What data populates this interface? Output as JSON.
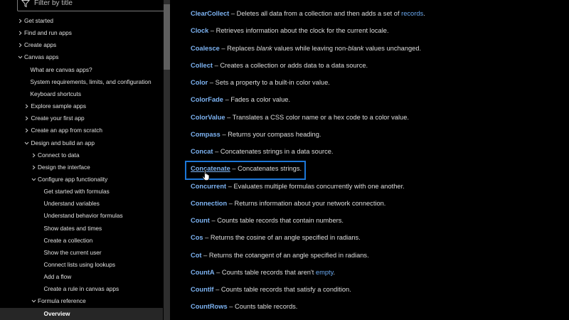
{
  "sidebar": {
    "filter_placeholder": "Filter by title",
    "items": [
      {
        "label": "Get started",
        "chevron": "right"
      },
      {
        "label": "Find and run apps",
        "chevron": "right"
      },
      {
        "label": "Create apps",
        "chevron": "right"
      },
      {
        "label": "Canvas apps",
        "chevron": "down"
      },
      {
        "label": "What are canvas apps?",
        "chevron": ""
      },
      {
        "label": "System requirements, limits, and configuration",
        "chevron": ""
      },
      {
        "label": "Keyboard shortcuts",
        "chevron": ""
      },
      {
        "label": "Explore sample apps",
        "chevron": "right"
      },
      {
        "label": "Create your first app",
        "chevron": "right"
      },
      {
        "label": "Create an app from scratch",
        "chevron": "right"
      },
      {
        "label": "Design and build an app",
        "chevron": "down"
      },
      {
        "label": "Connect to data",
        "chevron": "right"
      },
      {
        "label": "Design the interface",
        "chevron": "right"
      },
      {
        "label": "Configure app functionality",
        "chevron": "down"
      },
      {
        "label": "Get started with formulas",
        "chevron": ""
      },
      {
        "label": "Understand variables",
        "chevron": ""
      },
      {
        "label": "Understand behavior formulas",
        "chevron": ""
      },
      {
        "label": "Show dates and times",
        "chevron": ""
      },
      {
        "label": "Create a collection",
        "chevron": ""
      },
      {
        "label": "Show the current user",
        "chevron": ""
      },
      {
        "label": "Connect lists using lookups",
        "chevron": ""
      },
      {
        "label": "Add a flow",
        "chevron": ""
      },
      {
        "label": "Create a rule in canvas apps",
        "chevron": ""
      },
      {
        "label": "Formula reference",
        "chevron": "down"
      },
      {
        "label": "Overview",
        "chevron": "",
        "selected": true
      }
    ]
  },
  "content": {
    "entries": [
      {
        "name": "ClearCollect",
        "parts": [
          {
            "t": " – Deletes all data from a collection and then adds a set of "
          },
          {
            "t": "records",
            "s": "link"
          },
          {
            "t": "."
          }
        ]
      },
      {
        "name": "Clock",
        "parts": [
          {
            "t": " – Retrieves information about the clock for the current locale."
          }
        ]
      },
      {
        "name": "Coalesce",
        "parts": [
          {
            "t": " – Replaces "
          },
          {
            "t": "blank",
            "s": "em"
          },
          {
            "t": " values while leaving non-"
          },
          {
            "t": "blank",
            "s": "em"
          },
          {
            "t": " values unchanged."
          }
        ]
      },
      {
        "name": "Collect",
        "parts": [
          {
            "t": " – Creates a collection or adds data to a data source."
          }
        ]
      },
      {
        "name": "Color",
        "parts": [
          {
            "t": " – Sets a property to a built-in color value."
          }
        ]
      },
      {
        "name": "ColorFade",
        "parts": [
          {
            "t": " – Fades a color value."
          }
        ]
      },
      {
        "name": "ColorValue",
        "parts": [
          {
            "t": " – Translates a CSS color name or a hex code to a color value."
          }
        ]
      },
      {
        "name": "Compass",
        "parts": [
          {
            "t": " – Returns your compass heading."
          }
        ]
      },
      {
        "name": "Concat",
        "parts": [
          {
            "t": " – Concatenates strings in a data source."
          }
        ]
      },
      {
        "name": "Concatenate",
        "parts": [
          {
            "t": " – Concatenates strings."
          }
        ],
        "highlighted": true
      },
      {
        "name": "Concurrent",
        "parts": [
          {
            "t": " – Evaluates multiple formulas concurrently with one another."
          }
        ]
      },
      {
        "name": "Connection",
        "parts": [
          {
            "t": " – Returns information about your network connection."
          }
        ]
      },
      {
        "name": "Count",
        "parts": [
          {
            "t": " – Counts table records that contain numbers."
          }
        ]
      },
      {
        "name": "Cos",
        "parts": [
          {
            "t": " – Returns the cosine of an angle specified in radians."
          }
        ]
      },
      {
        "name": "Cot",
        "parts": [
          {
            "t": " – Returns the cotangent of an angle specified in radians."
          }
        ]
      },
      {
        "name": "CountA",
        "parts": [
          {
            "t": " – Counts table records that aren't "
          },
          {
            "t": "empty",
            "s": "link"
          },
          {
            "t": "."
          }
        ]
      },
      {
        "name": "CountIf",
        "parts": [
          {
            "t": " – Counts table records that satisfy a condition."
          }
        ]
      },
      {
        "name": "CountRows",
        "parts": [
          {
            "t": " – Counts table records."
          }
        ]
      }
    ]
  },
  "colors": {
    "background": "#000000",
    "function_link": "#7db3f2",
    "inline_link": "#6aa9f0",
    "highlight_border": "#1c76d6",
    "selected_item_bg": "#262626"
  },
  "icons": {
    "filter": "filter-icon",
    "chevron_right": "chevron-right-icon",
    "chevron_down": "chevron-down-icon",
    "cursor": "hand-pointer-cursor"
  }
}
